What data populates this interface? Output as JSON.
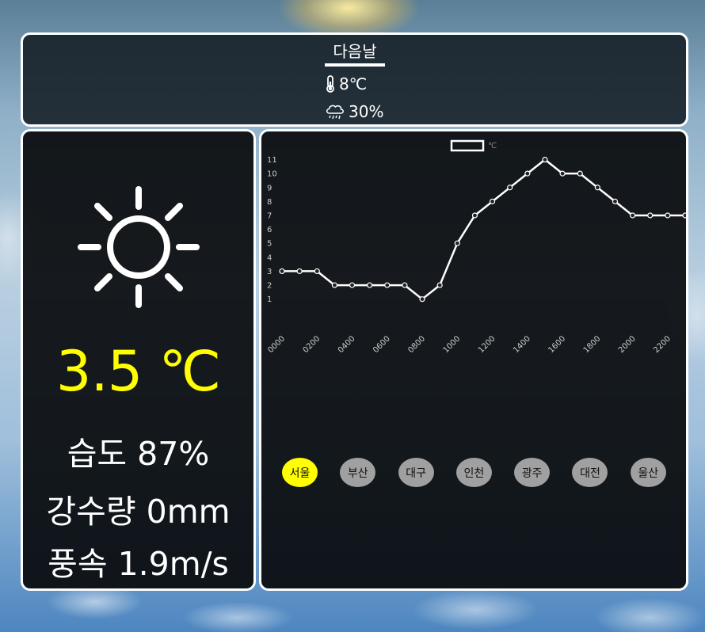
{
  "forecast": {
    "title": "다음날",
    "temperature": "8℃",
    "rain_probability": "30%"
  },
  "current": {
    "icon": "sun-icon",
    "temperature": "3.5 ℃",
    "humidity": "습도 87%",
    "precipitation": "강수량 0mm",
    "wind": "풍속 1.9m/s",
    "accent_color": "#ffff00"
  },
  "cities": [
    {
      "label": "서울",
      "active": true
    },
    {
      "label": "부산",
      "active": false
    },
    {
      "label": "대구",
      "active": false
    },
    {
      "label": "인천",
      "active": false
    },
    {
      "label": "광주",
      "active": false
    },
    {
      "label": "대전",
      "active": false
    },
    {
      "label": "울산",
      "active": false
    }
  ],
  "chart_data": {
    "type": "line",
    "legend": [
      "℃"
    ],
    "x": [
      "0000",
      "0100",
      "0200",
      "0300",
      "0400",
      "0500",
      "0600",
      "0700",
      "0800",
      "0900",
      "1000",
      "1100",
      "1200",
      "1300",
      "1400",
      "1500",
      "1600",
      "1700",
      "1800",
      "1900",
      "2000",
      "2100",
      "2200",
      "2300"
    ],
    "x_tick_labels": [
      "0000",
      "0200",
      "0400",
      "0600",
      "0800",
      "1000",
      "1200",
      "1400",
      "1600",
      "1800",
      "2000",
      "2200"
    ],
    "y_tick_labels": [
      1,
      2,
      3,
      4,
      5,
      6,
      7,
      8,
      9,
      10,
      11
    ],
    "series": [
      {
        "values": [
          3,
          3,
          3,
          2,
          2,
          2,
          2,
          2,
          1,
          2,
          5,
          7,
          8,
          9,
          10,
          11,
          10,
          10,
          9,
          8,
          7,
          7,
          7,
          7
        ]
      }
    ],
    "ylim": [
      0.3,
      11.2
    ],
    "grid": false,
    "legend_position": "top-center",
    "line_color": "#ffffff"
  }
}
